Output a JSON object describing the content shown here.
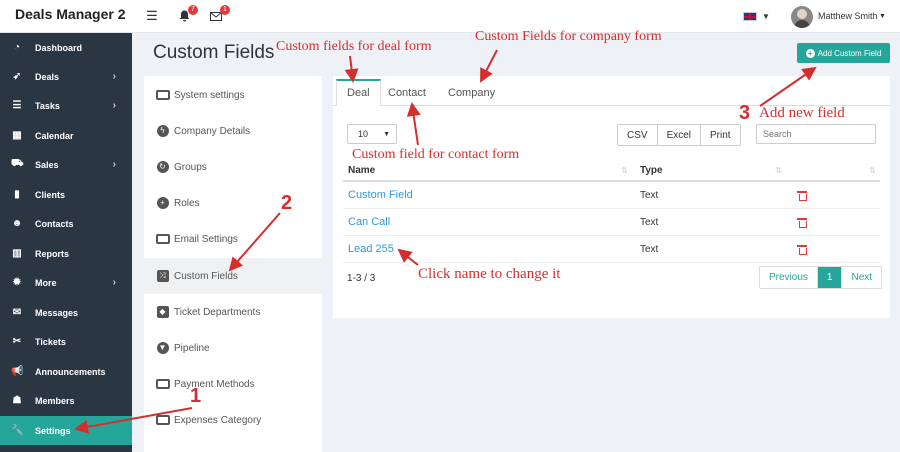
{
  "app": {
    "brand": "Deals Manager 2"
  },
  "topbar": {
    "menu_icon": "hamburger-icon",
    "notifications_icon": "bell-icon",
    "notifications_count": "7",
    "messages_icon": "envelope-icon",
    "messages_count": "1",
    "language": "uk-flag-icon",
    "user_name": "Matthew Smith"
  },
  "sidebar": {
    "items": [
      {
        "label": "Dashboard",
        "icon": "dashboard-icon",
        "glyph": "◔",
        "has_arrow": false
      },
      {
        "label": "Deals",
        "icon": "rocket-icon",
        "glyph": "➶",
        "has_arrow": true
      },
      {
        "label": "Tasks",
        "icon": "tasks-icon",
        "glyph": "☰",
        "has_arrow": true
      },
      {
        "label": "Calendar",
        "icon": "calendar-icon",
        "glyph": "▦",
        "has_arrow": false
      },
      {
        "label": "Sales",
        "icon": "cart-icon",
        "glyph": "⛟",
        "has_arrow": true
      },
      {
        "label": "Clients",
        "icon": "building-icon",
        "glyph": "▮",
        "has_arrow": false
      },
      {
        "label": "Contacts",
        "icon": "users-icon",
        "glyph": "☻",
        "has_arrow": false
      },
      {
        "label": "Reports",
        "icon": "bar-chart-icon",
        "glyph": "▥",
        "has_arrow": false
      },
      {
        "label": "More",
        "icon": "cog-icon",
        "glyph": "✹",
        "has_arrow": true
      },
      {
        "label": "Messages",
        "icon": "envelope-icon",
        "glyph": "✉",
        "has_arrow": false
      },
      {
        "label": "Tickets",
        "icon": "tag-icon",
        "glyph": "✂",
        "has_arrow": false
      },
      {
        "label": "Announcements",
        "icon": "bullhorn-icon",
        "glyph": "📢",
        "has_arrow": false
      },
      {
        "label": "Members",
        "icon": "user-icon",
        "glyph": "☗",
        "has_arrow": false
      },
      {
        "label": "Settings",
        "icon": "wrench-icon",
        "glyph": "🔧",
        "has_arrow": false,
        "active": true
      }
    ]
  },
  "page": {
    "title": "Custom Fields"
  },
  "settings_menu": {
    "items": [
      {
        "label": "System settings",
        "icon": "monitor-icon"
      },
      {
        "label": "Company Details",
        "icon": "bolt-icon"
      },
      {
        "label": "Groups",
        "icon": "refresh-icon"
      },
      {
        "label": "Roles",
        "icon": "plus-circle-icon"
      },
      {
        "label": "Email Settings",
        "icon": "envelope-box-icon"
      },
      {
        "label": "Custom Fields",
        "icon": "random-icon",
        "active": true
      },
      {
        "label": "Ticket Departments",
        "icon": "tag-icon"
      },
      {
        "label": "Pipeline",
        "icon": "filter-icon"
      },
      {
        "label": "Payment Methods",
        "icon": "credit-card-icon"
      },
      {
        "label": "Expenses Category",
        "icon": "money-icon"
      }
    ]
  },
  "tabs": [
    "Deal",
    "Contact",
    "Company"
  ],
  "toolbar": {
    "page_size": "10",
    "buttons": [
      "CSV",
      "Excel",
      "Print"
    ],
    "search_placeholder": "Search",
    "add_button": "Add Custom Field"
  },
  "table": {
    "columns": [
      "Name",
      "Type"
    ],
    "rows": [
      {
        "name": "Custom Field",
        "type": "Text"
      },
      {
        "name": "Can Call",
        "type": "Text"
      },
      {
        "name": "Lead 255",
        "type": "Text"
      }
    ],
    "count": "1-3 / 3",
    "pagination": {
      "previous": "Previous",
      "current": "1",
      "next": "Next"
    }
  },
  "annotations": {
    "deal_form": "Custom fields for deal form",
    "company_form": "Custom Fields for company form",
    "contact_form": "Custom field for contact form",
    "add_field_num": "3",
    "add_field": "Add new field",
    "custom_fields_num": "2",
    "click_name": "Click name to change it",
    "settings_num": "1"
  },
  "colors": {
    "sidebar": "#2b3643",
    "accent": "#26a69a",
    "link": "#3598dc",
    "annotation": "#d32f2f",
    "delete": "#e53935"
  }
}
